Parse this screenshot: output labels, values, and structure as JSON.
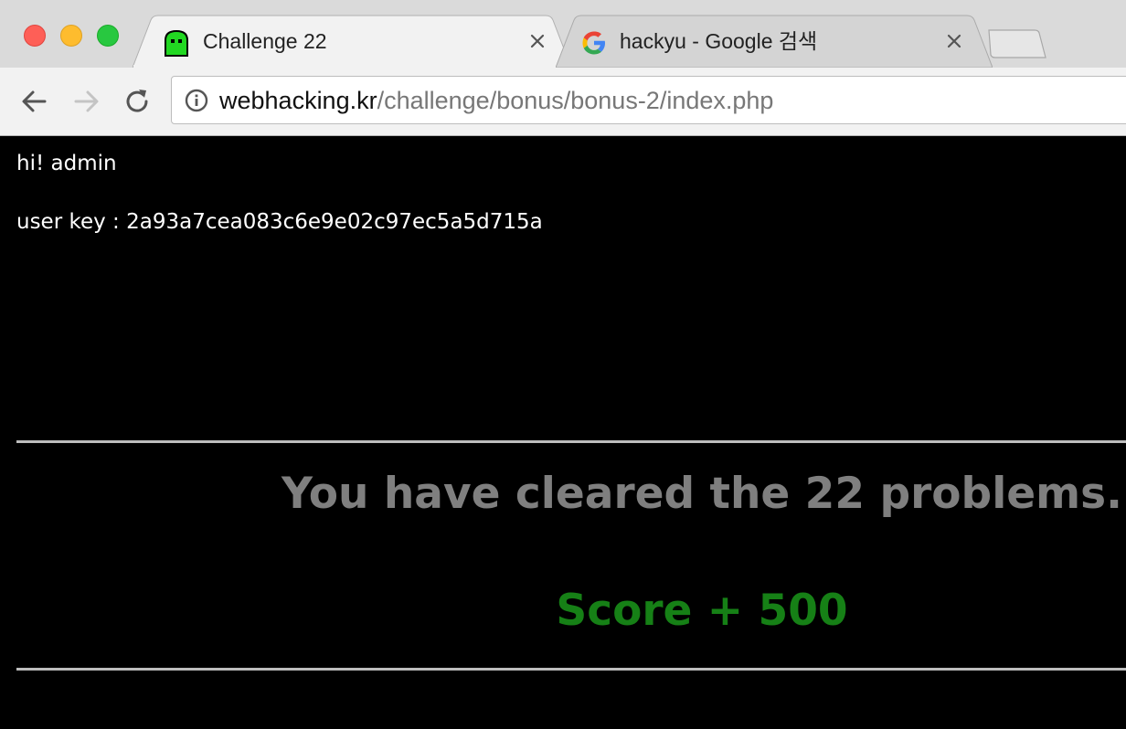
{
  "window": {
    "controls": [
      "close",
      "minimize",
      "zoom"
    ]
  },
  "tabs": [
    {
      "title": "Challenge 22",
      "icon": "green-ghost-favicon",
      "active": true
    },
    {
      "title": "hackyu - Google 검색",
      "icon": "google-g-favicon",
      "active": false
    }
  ],
  "toolbar": {
    "url_host": "webhacking.kr",
    "url_path": "/challenge/bonus/bonus-2/index.php"
  },
  "page": {
    "greeting": "hi! admin",
    "user_key_line": "user key : 2a93a7cea083c6e9e02c97ec5a5d715a",
    "cleared_message": "You have cleared the 22 problems.",
    "score_message": "Score + 500"
  },
  "colors": {
    "page_background": "#000000",
    "cleared_text": "#7f7f7f",
    "score_text": "#168016"
  }
}
